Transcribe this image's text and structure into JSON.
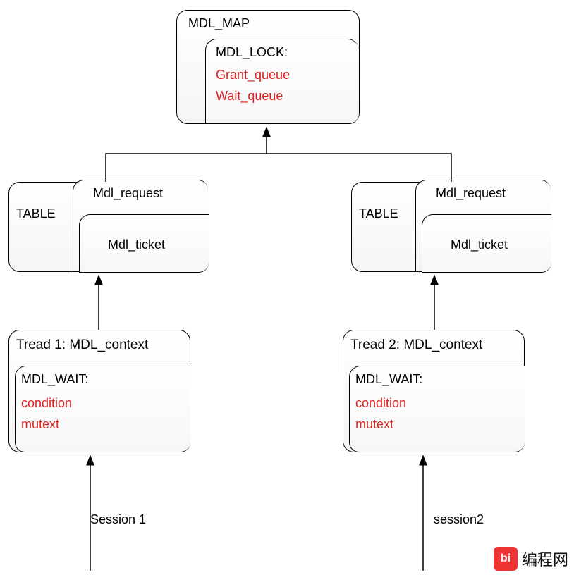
{
  "top": {
    "title": "MDL_MAP",
    "lock_title": "MDL_LOCK:",
    "lock_grant": "Grant_queue",
    "lock_wait": "Wait_queue"
  },
  "left": {
    "table_label": "TABLE",
    "request_label": "Mdl_request",
    "ticket_label": "Mdl_ticket",
    "thread_title": "Tread 1: MDL_context",
    "wait_title": "MDL_WAIT:",
    "wait_cond": "condition",
    "wait_mutex": "mutext",
    "session_label": "Session 1"
  },
  "right": {
    "table_label": "TABLE",
    "request_label": "Mdl_request",
    "ticket_label": "Mdl_ticket",
    "thread_title": "Tread 2: MDL_context",
    "wait_title": "MDL_WAIT:",
    "wait_cond": "condition",
    "wait_mutex": "mutext",
    "session_label": "session2"
  },
  "watermark": {
    "logo": "bi",
    "text": "编程网"
  },
  "chart_data": {
    "type": "diagram",
    "description": "Hierarchical diagram of MDL (metadata lock) structures in a database system",
    "nodes": [
      {
        "id": "mdl_map",
        "label": "MDL_MAP",
        "children": [
          "mdl_lock"
        ]
      },
      {
        "id": "mdl_lock",
        "label": "MDL_LOCK:",
        "fields": [
          "Grant_queue",
          "Wait_queue"
        ]
      },
      {
        "id": "table1",
        "label": "TABLE",
        "children": [
          "mdl_request1"
        ]
      },
      {
        "id": "mdl_request1",
        "label": "Mdl_request",
        "children": [
          "mdl_ticket1"
        ]
      },
      {
        "id": "mdl_ticket1",
        "label": "Mdl_ticket"
      },
      {
        "id": "thread1",
        "label": "Tread 1: MDL_context",
        "children": [
          "mdl_wait1"
        ]
      },
      {
        "id": "mdl_wait1",
        "label": "MDL_WAIT:",
        "fields": [
          "condition",
          "mutext"
        ]
      },
      {
        "id": "table2",
        "label": "TABLE",
        "children": [
          "mdl_request2"
        ]
      },
      {
        "id": "mdl_request2",
        "label": "Mdl_request",
        "children": [
          "mdl_ticket2"
        ]
      },
      {
        "id": "mdl_ticket2",
        "label": "Mdl_ticket"
      },
      {
        "id": "thread2",
        "label": "Tread 2: MDL_context",
        "children": [
          "mdl_wait2"
        ]
      },
      {
        "id": "mdl_wait2",
        "label": "MDL_WAIT:",
        "fields": [
          "condition",
          "mutext"
        ]
      }
    ],
    "edges": [
      {
        "from": "table1",
        "to": "mdl_map"
      },
      {
        "from": "table2",
        "to": "mdl_map"
      },
      {
        "from": "thread1",
        "to": "table1"
      },
      {
        "from": "thread2",
        "to": "table2"
      },
      {
        "from": "session1",
        "to": "thread1",
        "label": "Session 1"
      },
      {
        "from": "session2",
        "to": "thread2",
        "label": "session2"
      }
    ]
  }
}
